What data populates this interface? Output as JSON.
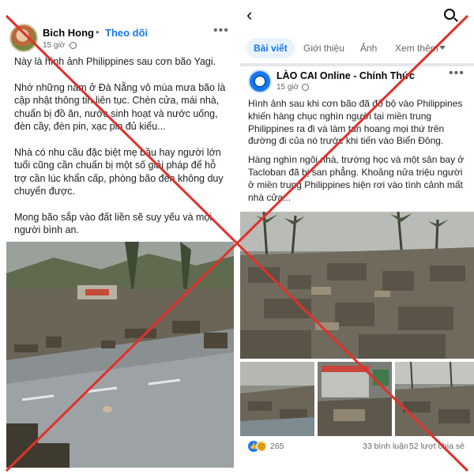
{
  "left_post": {
    "author": "Bich Hong",
    "separator": "•",
    "follow_label": "Theo dõi",
    "time": "15 giờ ·",
    "more_label": "•••",
    "paragraphs": [
      "Này là hình ảnh Philippines sau cơn bão Yagi.",
      "Nhớ những năm ở Đà Nẵng vô mùa mưa bão là cập nhật thông tin liên tục. Chèn cửa, mái nhà, chuẩn bị đồ ăn, nước sinh hoạt và nước uống, đèn cầy, đèn pin, xạc pin đủ kiểu...",
      "Nhà có nhu cầu đặc biệt mẹ bầu hay người lớn tuổi cũng cần chuẩn bị một số giải pháp để hỗ trợ cần lúc khẩn cấp, phòng bão đến không duy chuyển được.",
      "Mong bão sắp vào đất liền sẽ suy yếu và mọi người bình an."
    ]
  },
  "right_page": {
    "back_label": "‹",
    "tabs": [
      {
        "label": "Bài viết",
        "active": true
      },
      {
        "label": "Giới thiệu",
        "active": false
      },
      {
        "label": "Ảnh",
        "active": false
      },
      {
        "label": "Xem thêm",
        "active": false
      }
    ],
    "post": {
      "author": "LÀO CAI Online - Chính Thức",
      "time": "15 giờ ·",
      "more_label": "•••",
      "paragraphs": [
        "Hình ảnh sau khi cơn bão đã đổ bộ vào Philippines khiến hàng chục nghìn người tại miền trung Philippines ra đi và làm tan hoang mọi thứ trên đường đi của nó trước khi tiến vào Biển Đông.",
        "Hàng nghìn ngôi nhà, trường học và một sân bay ở Tacloban đã bị san phẳng. Khoảng nửa triệu người ở miền trung Philippines hiện rơi vào tình cảnh mất nhà cửa..."
      ],
      "reaction_count": "265",
      "comments": "33 bình luận",
      "shares": "52 lượt chia sẻ"
    }
  },
  "colors": {
    "brand": "#1877f2",
    "tab_bg": "#e7f3ff",
    "secondary_text": "#65676b",
    "cross": "#e0322b"
  },
  "icons": {
    "search": "search-icon",
    "back": "back-arrow-icon",
    "globe": "globe-icon",
    "more": "more-dots-icon",
    "caret": "caret-down-icon"
  }
}
